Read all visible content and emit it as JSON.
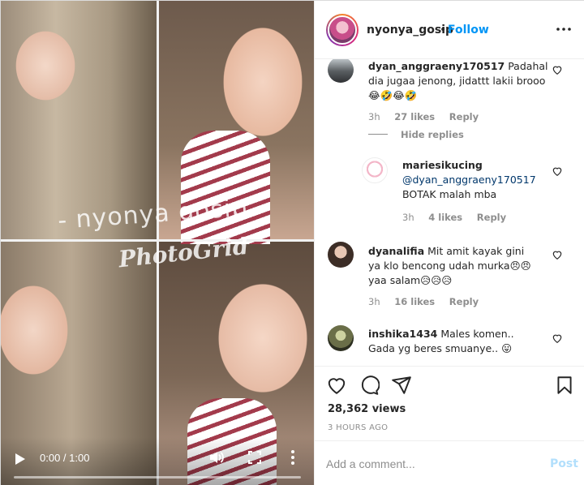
{
  "video": {
    "watermark_top": "- nyonya gosip -",
    "watermark_bottom": "PhotoGrid",
    "time": "0:00 / 1:00"
  },
  "header": {
    "username": "nyonya_gosip",
    "separator": "•",
    "follow_label": "Follow"
  },
  "comments": [
    {
      "username": "dyan_anggraeny170517",
      "text": " Padahal dia jugaa jenong, jidattt lakii brooo😂🤣😂🤣",
      "time": "3h",
      "likes": "27 likes",
      "reply": "Reply",
      "hide_replies": "Hide replies"
    },
    {
      "username": "mariesikucing",
      "mention": "@dyan_anggraeny170517",
      "text": " BOTAK malah mba",
      "time": "3h",
      "likes": "4 likes",
      "reply": "Reply"
    },
    {
      "username": "dyanalifia",
      "text": " Mit amit kayak gini ya klo bencong udah murka😠😠 yaa salam😥😥😥",
      "time": "3h",
      "likes": "16 likes",
      "reply": "Reply"
    },
    {
      "username": "inshika1434",
      "text": " Males komen.. Gada yg beres smuanye.. 😛"
    }
  ],
  "actions": {
    "views": "28,362 views",
    "posted": "3 HOURS AGO"
  },
  "add_comment": {
    "placeholder": "Add a comment...",
    "post_label": "Post"
  },
  "colors": {
    "accent": "#0095f6",
    "post_disabled": "#b2dffc",
    "muted": "#8e8e8e"
  }
}
